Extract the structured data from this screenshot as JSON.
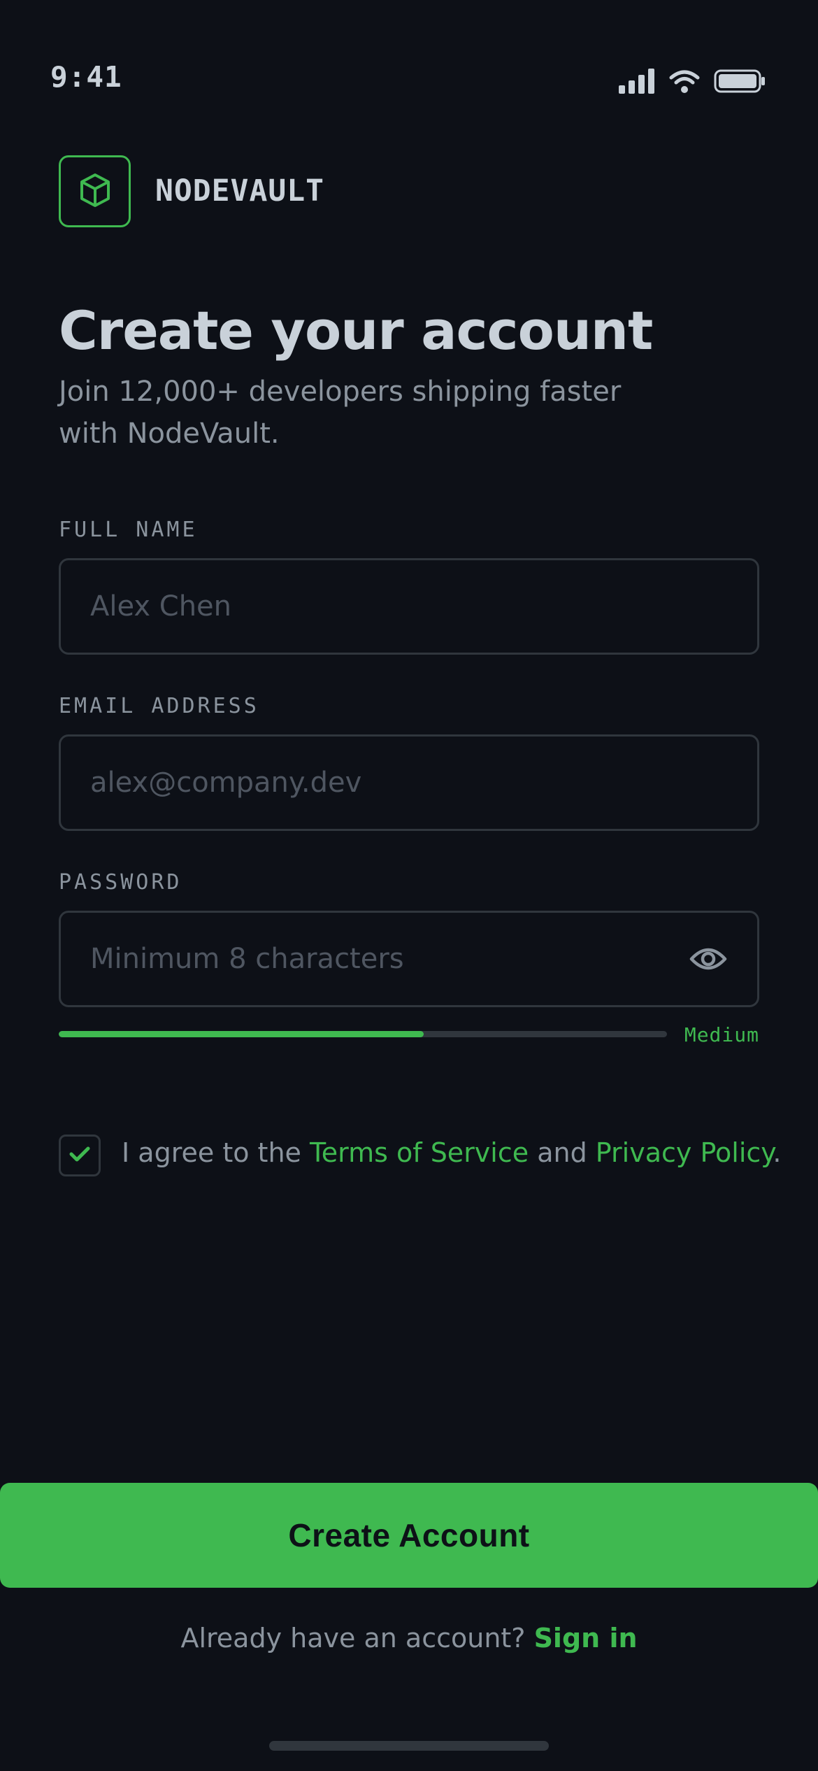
{
  "status_bar": {
    "time": "9:41"
  },
  "brand": {
    "name": "NODEVAULT",
    "logo_icon": "cube-icon",
    "accent_color": "#3fb950"
  },
  "header": {
    "title": "Create your account",
    "subtitle": "Join 12,000+ developers shipping faster with NodeVault."
  },
  "form": {
    "full_name": {
      "label": "FULL NAME",
      "placeholder": "Alex Chen",
      "value": ""
    },
    "email": {
      "label": "EMAIL ADDRESS",
      "placeholder": "alex@company.dev",
      "value": ""
    },
    "password": {
      "label": "PASSWORD",
      "placeholder": "Minimum 8 characters",
      "value": "",
      "toggle_icon": "eye-icon"
    },
    "strength": {
      "label": "Medium",
      "level": 0.6
    },
    "agreement": {
      "checked": true,
      "prefix": "I agree to the ",
      "terms_link": "Terms of Service",
      "middle": " and ",
      "privacy_link": "Privacy Policy",
      "suffix": "."
    }
  },
  "actions": {
    "create_label": "Create Account",
    "signin_prompt": "Already have an account? ",
    "signin_link": "Sign in"
  }
}
